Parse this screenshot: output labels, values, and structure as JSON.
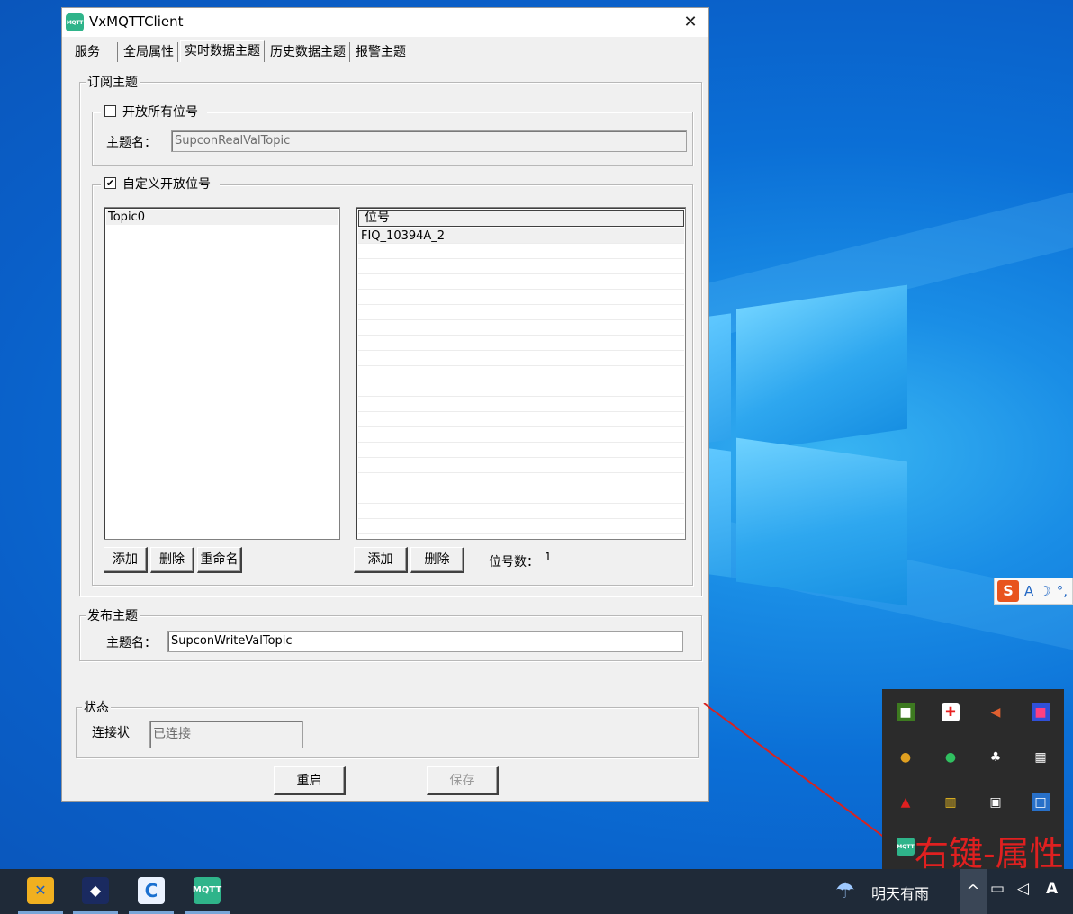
{
  "window": {
    "title": "VxMQTTClient",
    "app_icon_text": "MQTT",
    "close_glyph": "✕"
  },
  "tabs": [
    {
      "label": "服务"
    },
    {
      "label": "全局属性"
    },
    {
      "label": "实时数据主题"
    },
    {
      "label": "历史数据主题"
    },
    {
      "label": "报警主题"
    }
  ],
  "subscribe": {
    "group_title": "订阅主题",
    "open_all": {
      "label": "开放所有位号",
      "checked_glyph": "",
      "topic_label": "主题名：",
      "topic_value": "SupconRealValTopic"
    },
    "custom": {
      "label": "自定义开放位号",
      "checked_glyph": "✔",
      "topics": [
        "Topic0"
      ],
      "tag_header": "位号",
      "tags": [
        "FIQ_10394A_2"
      ],
      "add_label": "添加",
      "delete_label": "删除",
      "rename_label": "重命名",
      "tag_add_label": "添加",
      "tag_delete_label": "删除",
      "tag_count_label": "位号数：",
      "tag_count_value": "1"
    }
  },
  "publish": {
    "group_title": "发布主题",
    "topic_label": "主题名：",
    "topic_value": "SupconWriteValTopic"
  },
  "status": {
    "group_title": "状态",
    "connection_label": "连接状",
    "connection_value": "已连接"
  },
  "footer": {
    "restart_label": "重启",
    "save_label": "保存"
  },
  "annotation": {
    "hint_text": "右键-属性",
    "hint_color": "#e02020"
  },
  "ime": {
    "logo": "S",
    "mode": "A",
    "moon": "☽",
    "dot": "°,"
  },
  "taskbar": {
    "weather_text": "明天有雨",
    "show_hidden_glyph": "^",
    "input_indicator": "A",
    "mqtt_icon_text": "MQTT"
  },
  "colors": {
    "accent_mqtt": "#2fb48a",
    "desktop_blue": "#0b6fd6",
    "taskbar": "#1f2a38"
  },
  "icons": {
    "tray": [
      "nvidia-icon",
      "security-shield-icon",
      "volume-muted-icon",
      "app-square-icon",
      "remote-icon",
      "globe-icon",
      "network-tree-icon",
      "keyboard-icon",
      "red-app-icon",
      "colored-bars-icon",
      "network-monitor-icon",
      "intel-icon",
      "mqtt-icon"
    ]
  }
}
